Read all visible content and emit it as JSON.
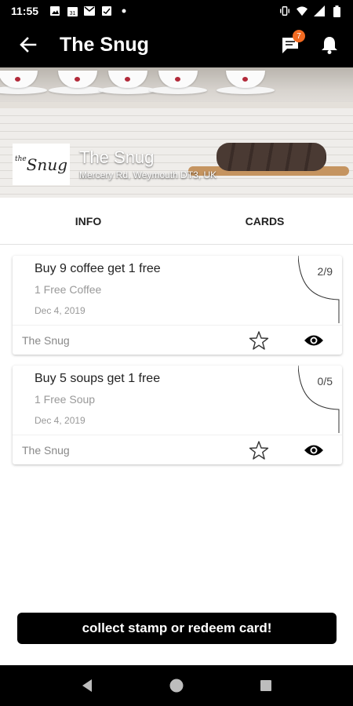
{
  "status_bar": {
    "time": "11:55",
    "left_icons": [
      "photo-icon",
      "calendar-icon",
      "mail-icon",
      "image-check-icon",
      "dot-icon"
    ],
    "calendar_day": "31",
    "right_icons": [
      "vibrate-icon",
      "wifi-icon",
      "signal-icon",
      "battery-icon"
    ]
  },
  "app_bar": {
    "title": "The Snug",
    "notification_count": "7"
  },
  "hero": {
    "logo_text": "Snug",
    "logo_small": "the",
    "name": "The Snug",
    "address": "Mercery Rd, Weymouth DT3, UK"
  },
  "tabs": [
    {
      "label": "INFO"
    },
    {
      "label": "CARDS"
    }
  ],
  "cards": [
    {
      "title": "Buy 9 coffee get 1 free",
      "subtitle": "1 Free Coffee",
      "date": "Dec 4, 2019",
      "progress": "2/9",
      "shop": "The Snug"
    },
    {
      "title": "Buy 5 soups get 1 free",
      "subtitle": "1 Free Soup",
      "date": "Dec 4, 2019",
      "progress": "0/5",
      "shop": "The Snug"
    }
  ],
  "main_button": {
    "label": "collect stamp or redeem card!"
  },
  "colors": {
    "accent_badge": "#f26a21",
    "bar": "#000000"
  }
}
